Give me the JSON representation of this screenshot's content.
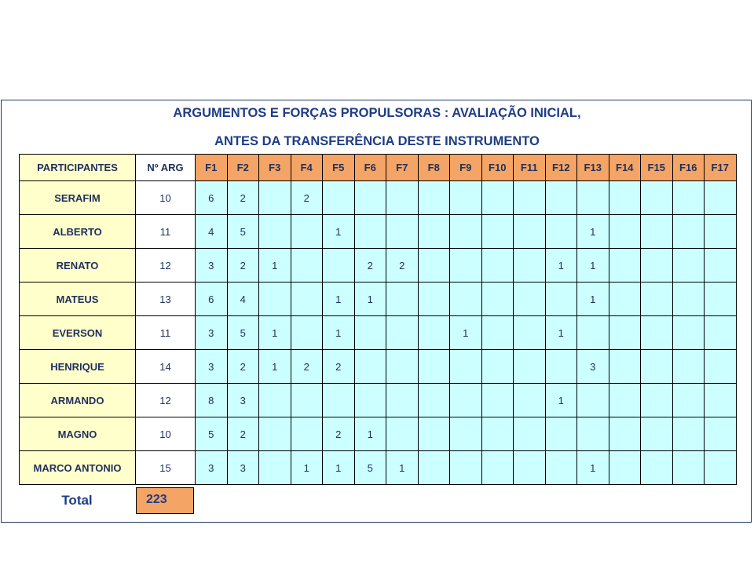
{
  "title": {
    "line1": "ARGUMENTOS  E FORÇAS PROPULSORAS  : AVALIAÇÃO INICIAL,",
    "line2": "ANTES DA TRANSFERÊNCIA DESTE INSTRUMENTO"
  },
  "table": {
    "header": {
      "participants": "PARTICIPANTES",
      "num_args": "Nº ARG",
      "forces": [
        "F1",
        "F2",
        "F3",
        "F4",
        "F5",
        "F6",
        "F7",
        "F8",
        "F9",
        "F10",
        "F11",
        "F12",
        "F13",
        "F14",
        "F15",
        "F16",
        "F17"
      ]
    },
    "rows": [
      {
        "name": "SERAFIM",
        "args": "10",
        "f": [
          "6",
          "2",
          "",
          "2",
          "",
          "",
          "",
          "",
          "",
          "",
          "",
          "",
          "",
          "",
          "",
          "",
          ""
        ]
      },
      {
        "name": "ALBERTO",
        "args": "11",
        "f": [
          "4",
          "5",
          "",
          "",
          "1",
          "",
          "",
          "",
          "",
          "",
          "",
          "",
          "1",
          "",
          "",
          "",
          ""
        ]
      },
      {
        "name": "RENATO",
        "args": "12",
        "f": [
          "3",
          "2",
          "1",
          "",
          "",
          "2",
          "2",
          "",
          "",
          "",
          "",
          "1",
          "1",
          "",
          "",
          "",
          ""
        ]
      },
      {
        "name": "MATEUS",
        "args": "13",
        "f": [
          "6",
          "4",
          "",
          "",
          "1",
          "1",
          "",
          "",
          "",
          "",
          "",
          "",
          "1",
          "",
          "",
          "",
          ""
        ]
      },
      {
        "name": "EVERSON",
        "args": "11",
        "f": [
          "3",
          "5",
          "1",
          "",
          "1",
          "",
          "",
          "",
          "1",
          "",
          "",
          "1",
          "",
          "",
          "",
          "",
          ""
        ]
      },
      {
        "name": "HENRIQUE",
        "args": "14",
        "f": [
          "3",
          "2",
          "1",
          "2",
          "2",
          "",
          "",
          "",
          "",
          "",
          "",
          "",
          "3",
          "",
          "",
          "",
          ""
        ]
      },
      {
        "name": "ARMANDO",
        "args": "12",
        "f": [
          "8",
          "3",
          "",
          "",
          "",
          "",
          "",
          "",
          "",
          "",
          "",
          "1",
          "",
          "",
          "",
          "",
          ""
        ]
      },
      {
        "name": "MAGNO",
        "args": "10",
        "f": [
          "5",
          "2",
          "",
          "",
          "2",
          "1",
          "",
          "",
          "",
          "",
          "",
          "",
          "",
          "",
          "",
          "",
          ""
        ]
      },
      {
        "name": "MARCO ANTONIO",
        "args": "15",
        "f": [
          "3",
          "3",
          "",
          "1",
          "1",
          "5",
          "1",
          "",
          "",
          "",
          "",
          "",
          "1",
          "",
          "",
          "",
          ""
        ]
      }
    ]
  },
  "total": {
    "label": "Total",
    "value": "223"
  },
  "colors": {
    "title_blue": "#1f3c88",
    "header_orange": "#f4a464",
    "header_text_yellow": "#ffff00",
    "name_bg": "#ffffcc",
    "cell_bg": "#ccffff",
    "arg_header_red": "#e0002a"
  }
}
